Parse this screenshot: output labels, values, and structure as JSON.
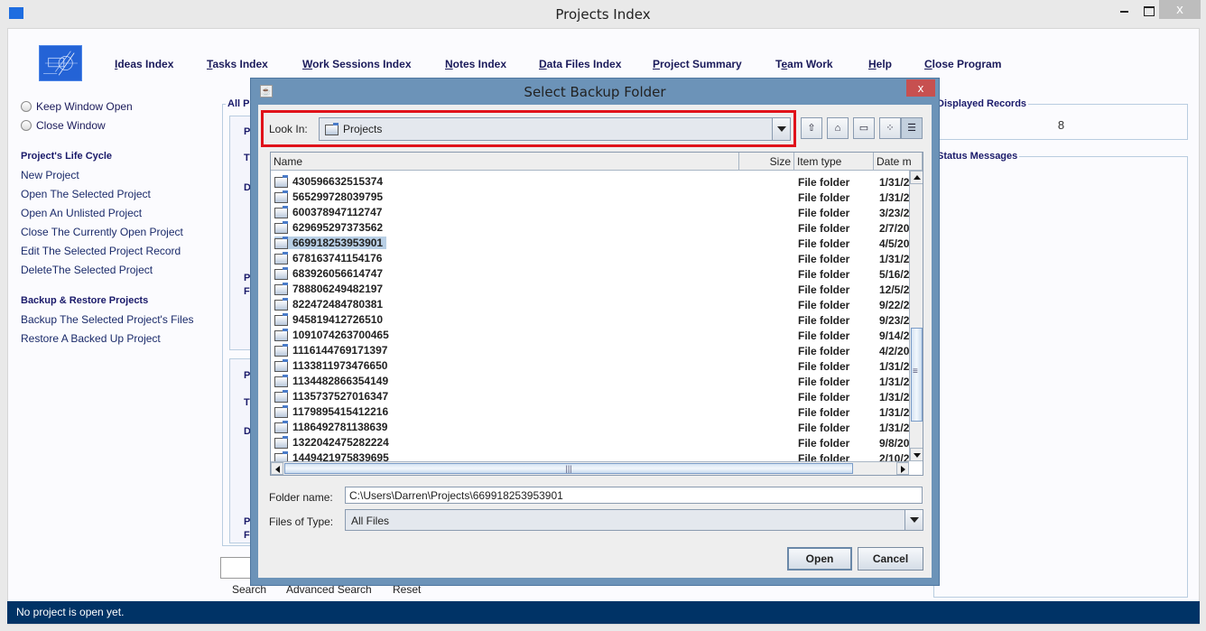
{
  "window": {
    "title": "Projects Index",
    "minimize_icon": "minimize-icon",
    "maximize_icon": "maximize-icon",
    "close_label": "x"
  },
  "nav": {
    "items": [
      {
        "label": "Ideas Index",
        "mnemonic": "I"
      },
      {
        "label": "Tasks Index",
        "mnemonic": "T"
      },
      {
        "label": "Work Sessions Index",
        "mnemonic": "W"
      },
      {
        "label": "Notes Index",
        "mnemonic": "N"
      },
      {
        "label": "Data Files Index",
        "mnemonic": "D"
      },
      {
        "label": "Project Summary",
        "mnemonic": "P"
      },
      {
        "label": "Team Work",
        "mnemonic": "e"
      },
      {
        "label": "Help",
        "mnemonic": "H"
      },
      {
        "label": "Close Program",
        "mnemonic": "C"
      }
    ]
  },
  "sidebar": {
    "radio_keep_open": "Keep Window Open",
    "radio_close": "Close Window",
    "lifecycle_title": "Project's Life Cycle",
    "lifecycle_items": [
      "New Project",
      "Open The Selected Project",
      "Open An Unlisted Project",
      "Close The Currently Open Project",
      "Edit The Selected Project Record",
      "DeleteThe Selected Project"
    ],
    "backup_title": "Backup & Restore Projects",
    "backup_items": [
      "Backup The Selected Project's Files",
      "Restore A Backed Up Project"
    ]
  },
  "center": {
    "group_title": "All P",
    "panel_letters": [
      "P",
      "T",
      "D",
      "P",
      "F"
    ],
    "search_links": [
      "Search",
      "Advanced Search",
      "Reset"
    ]
  },
  "right": {
    "records_title": "Displayed Records",
    "records_value": "8",
    "status_title": "Status Messages"
  },
  "statusbar": {
    "message": "No project is open yet."
  },
  "dialog": {
    "title": "Select Backup Folder",
    "close_label": "x",
    "look_in_label": "Look In:",
    "look_in_value": "Projects",
    "toolbar": [
      "up-one-level-icon",
      "home-icon",
      "new-folder-icon",
      "list-view-icon",
      "details-view-icon"
    ],
    "columns": [
      "Name",
      "Size",
      "Item type",
      "Date m"
    ],
    "files": [
      {
        "name": "430596632515374",
        "type": "File folder",
        "date": "1/31/2"
      },
      {
        "name": "565299728039795",
        "type": "File folder",
        "date": "1/31/2"
      },
      {
        "name": "600378947112747",
        "type": "File folder",
        "date": "3/23/2"
      },
      {
        "name": "629695297373562",
        "type": "File folder",
        "date": "2/7/20"
      },
      {
        "name": "669918253953901",
        "type": "File folder",
        "date": "4/5/20",
        "selected": true
      },
      {
        "name": "678163741154176",
        "type": "File folder",
        "date": "1/31/2"
      },
      {
        "name": "683926056614747",
        "type": "File folder",
        "date": "5/16/2"
      },
      {
        "name": "788806249482197",
        "type": "File folder",
        "date": "12/5/2"
      },
      {
        "name": "822472484780381",
        "type": "File folder",
        "date": "9/22/2"
      },
      {
        "name": "945819412726510",
        "type": "File folder",
        "date": "9/23/2"
      },
      {
        "name": "1091074263700465",
        "type": "File folder",
        "date": "9/14/2"
      },
      {
        "name": "1116144769171397",
        "type": "File folder",
        "date": "4/2/20"
      },
      {
        "name": "1133811973476650",
        "type": "File folder",
        "date": "1/31/2"
      },
      {
        "name": "1134482866354149",
        "type": "File folder",
        "date": "1/31/2"
      },
      {
        "name": "1135737527016347",
        "type": "File folder",
        "date": "1/31/2"
      },
      {
        "name": "1179895415412216",
        "type": "File folder",
        "date": "1/31/2"
      },
      {
        "name": "1186492781138639",
        "type": "File folder",
        "date": "1/31/2"
      },
      {
        "name": "1322042475282224",
        "type": "File folder",
        "date": "9/8/20"
      },
      {
        "name": "1449421975839695",
        "type": "File folder",
        "date": "2/10/2"
      }
    ],
    "folder_name_label": "Folder name:",
    "folder_name_value": "C:\\Users\\Darren\\Projects\\669918253953901",
    "files_of_type_label": "Files of Type:",
    "files_of_type_value": "All Files",
    "open_label": "Open",
    "cancel_label": "Cancel"
  }
}
